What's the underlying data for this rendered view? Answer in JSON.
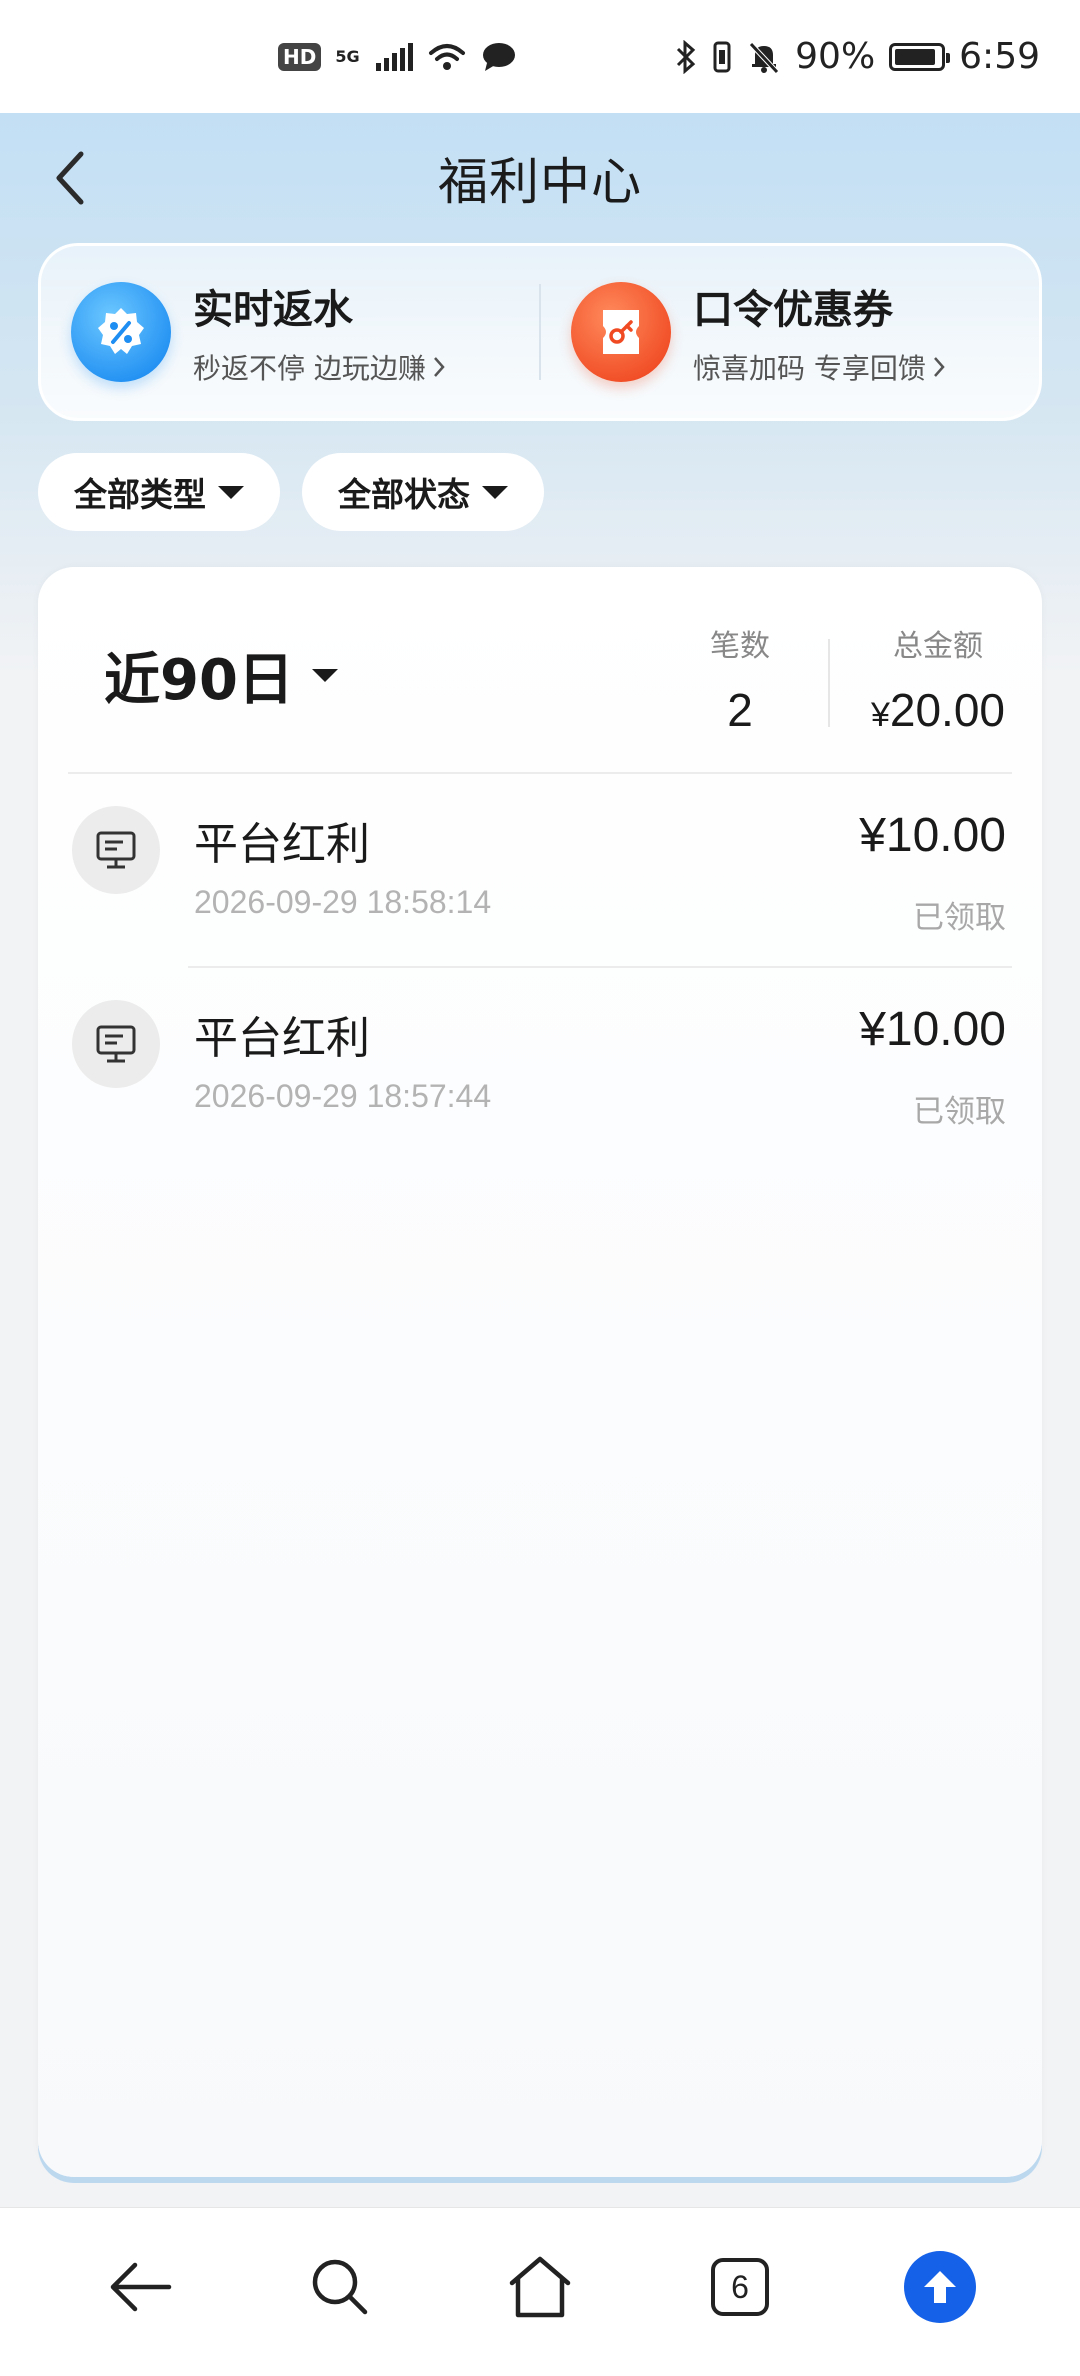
{
  "status_bar": {
    "network": "5G",
    "battery": "90%",
    "battery_level": 0.9,
    "time": "6:59"
  },
  "header": {
    "title": "福利中心"
  },
  "promos": [
    {
      "title": "实时返水",
      "subtitle": "秒返不停 边玩边赚",
      "icon": "percent-badge-icon",
      "color": "#1f8ef2"
    },
    {
      "title": "口令优惠券",
      "subtitle": "惊喜加码 专享回馈",
      "icon": "coupon-icon",
      "color": "#f04a23"
    }
  ],
  "filters": {
    "type": "全部类型",
    "status": "全部状态"
  },
  "summary": {
    "period": "近90日",
    "count_label": "笔数",
    "count_value": "2",
    "total_label": "总金额",
    "total_currency": "¥",
    "total_value": "20.00"
  },
  "records": [
    {
      "title": "平台红利",
      "time": "2026-09-29 18:58:14",
      "amount": "¥10.00",
      "status": "已领取"
    },
    {
      "title": "平台红利",
      "time": "2026-09-29 18:57:44",
      "amount": "¥10.00",
      "status": "已领取"
    }
  ],
  "bottom_nav": {
    "tab_count": "6"
  }
}
